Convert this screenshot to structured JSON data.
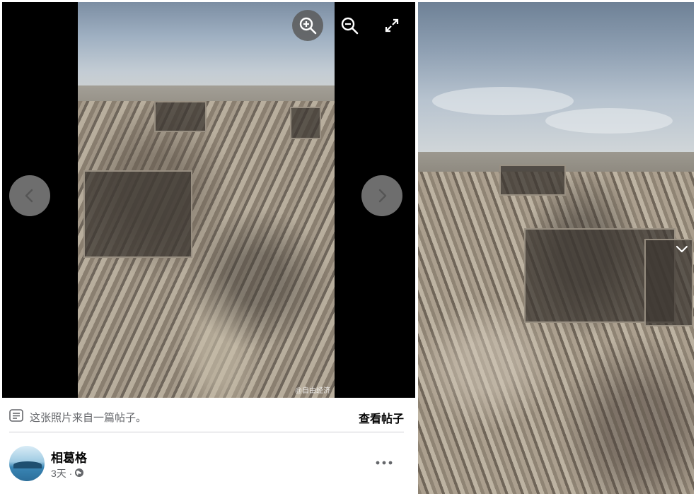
{
  "viewer": {
    "watermark": "@自由经济",
    "tools": {
      "zoom_in": "zoom-in-icon",
      "zoom_out": "zoom-out-icon",
      "fullscreen": "fullscreen-icon"
    },
    "nav": {
      "prev": "chevron-left-icon",
      "next": "chevron-right-icon"
    }
  },
  "post_info": {
    "text": "这张照片来自一篇帖子。",
    "view_post_label": "查看帖子"
  },
  "author": {
    "name": "相葛格",
    "time": "3天 ·",
    "privacy_icon": "globe-icon"
  },
  "colors": {
    "viewer_bg": "#000000",
    "secondary_text": "#65676b",
    "primary_text": "#050505",
    "divider": "#ced0d4"
  }
}
